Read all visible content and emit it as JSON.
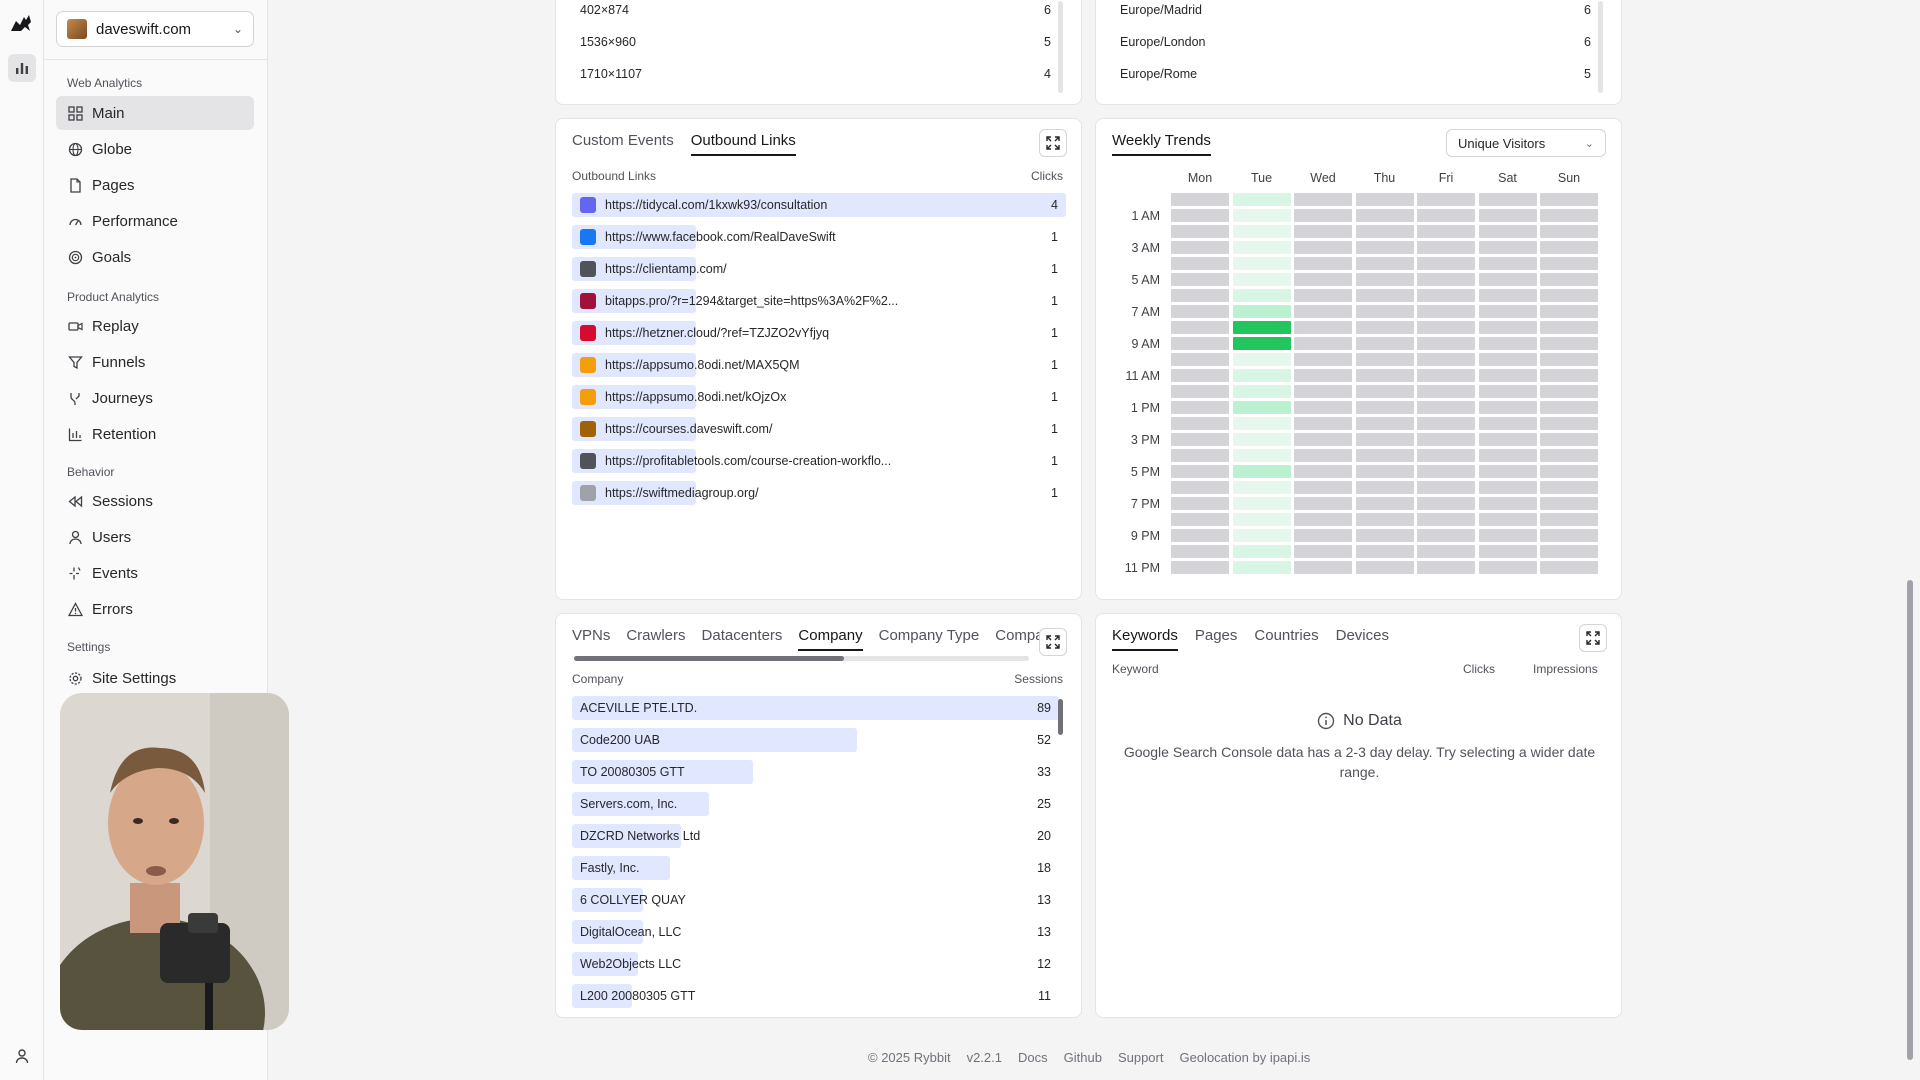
{
  "site_selector": {
    "name": "daveswift.com"
  },
  "sidebar": {
    "groups": [
      {
        "label": "Web Analytics",
        "items": [
          {
            "label": "Main",
            "icon": "grid-icon",
            "active": true
          },
          {
            "label": "Globe",
            "icon": "globe-icon"
          },
          {
            "label": "Pages",
            "icon": "file-icon"
          },
          {
            "label": "Performance",
            "icon": "gauge-icon"
          },
          {
            "label": "Goals",
            "icon": "target-icon"
          }
        ]
      },
      {
        "label": "Product Analytics",
        "items": [
          {
            "label": "Replay",
            "icon": "video-icon"
          },
          {
            "label": "Funnels",
            "icon": "funnel-icon"
          },
          {
            "label": "Journeys",
            "icon": "split-icon"
          },
          {
            "label": "Retention",
            "icon": "chart-icon"
          }
        ]
      },
      {
        "label": "Behavior",
        "items": [
          {
            "label": "Sessions",
            "icon": "rewind-icon"
          },
          {
            "label": "Users",
            "icon": "user-icon"
          },
          {
            "label": "Events",
            "icon": "sparkle-icon"
          },
          {
            "label": "Errors",
            "icon": "warning-icon"
          }
        ]
      },
      {
        "label": "Settings",
        "items": [
          {
            "label": "Site Settings",
            "icon": "gear-icon"
          }
        ]
      }
    ]
  },
  "screen_resolutions": {
    "rows": [
      {
        "label": "402×874",
        "value": "6"
      },
      {
        "label": "1536×960",
        "value": "5"
      },
      {
        "label": "1710×1107",
        "value": "4"
      }
    ]
  },
  "timezones": {
    "rows": [
      {
        "label": "Europe/Madrid",
        "value": "6"
      },
      {
        "label": "Europe/London",
        "value": "6"
      },
      {
        "label": "Europe/Rome",
        "value": "5"
      }
    ]
  },
  "events_card": {
    "tabs": [
      "Custom Events",
      "Outbound Links"
    ],
    "active_tab": 1,
    "col_label": "Outbound Links",
    "col_value": "Clicks",
    "rows": [
      {
        "url": "https://tidycal.com/1kxwk93/consultation",
        "clicks": "4",
        "share": 1.0,
        "icon": "calendar-icon",
        "color": "#6366f1"
      },
      {
        "url": "https://www.facebook.com/RealDaveSwift",
        "clicks": "1",
        "share": 0.25,
        "icon": "facebook-icon",
        "color": "#1877f2"
      },
      {
        "url": "https://clientamp.com/",
        "clicks": "1",
        "share": 0.25,
        "icon": "bars-icon",
        "color": "#52525b"
      },
      {
        "url": "bitapps.pro/?r=1294&target_site=https%3A%2F%2...",
        "clicks": "1",
        "share": 0.25,
        "icon": "bitapps-icon",
        "color": "#9f1239"
      },
      {
        "url": "https://hetzner.cloud/?ref=TZJZO2vYfjyq",
        "clicks": "1",
        "share": 0.25,
        "icon": "hetzner-icon",
        "color": "#d50c2d"
      },
      {
        "url": "https://appsumo.8odi.net/MAX5QM",
        "clicks": "1",
        "share": 0.25,
        "icon": "taco-icon",
        "color": "#f59e0b"
      },
      {
        "url": "https://appsumo.8odi.net/kOjzOx",
        "clicks": "1",
        "share": 0.25,
        "icon": "taco-icon",
        "color": "#f59e0b"
      },
      {
        "url": "https://courses.daveswift.com/",
        "clicks": "1",
        "share": 0.25,
        "icon": "avatar-icon",
        "color": "#a16207"
      },
      {
        "url": "https://profitabletools.com/course-creation-workflo...",
        "clicks": "1",
        "share": 0.25,
        "icon": "bars-icon",
        "color": "#52525b"
      },
      {
        "url": "https://swiftmediagroup.org/",
        "clicks": "1",
        "share": 0.25,
        "icon": "chevron-icon",
        "color": "#a1a1aa"
      }
    ]
  },
  "weekly_trends": {
    "title": "Weekly Trends",
    "metric": "Unique Visitors",
    "days": [
      "Mon",
      "Tue",
      "Wed",
      "Thu",
      "Fri",
      "Sat",
      "Sun"
    ],
    "hour_labels": [
      "1 AM",
      "3 AM",
      "5 AM",
      "7 AM",
      "9 AM",
      "11 AM",
      "1 PM",
      "3 PM",
      "5 PM",
      "7 PM",
      "9 PM",
      "11 PM"
    ],
    "tuesday_intensity": [
      0.1,
      0.05,
      0.05,
      0.05,
      0.05,
      0.05,
      0.1,
      0.35,
      0.9,
      1.0,
      0.05,
      0.1,
      0.1,
      0.3,
      0.05,
      0.05,
      0.05,
      0.35,
      0.05,
      0.05,
      0.05,
      0.05,
      0.1,
      0.1
    ]
  },
  "company_card": {
    "tabs": [
      "VPNs",
      "Crawlers",
      "Datacenters",
      "Company",
      "Company Type",
      "Compan"
    ],
    "active_tab": 3,
    "col_label": "Company",
    "col_value": "Sessions",
    "rows": [
      {
        "name": "ACEVILLE PTE.LTD.",
        "sessions": 89
      },
      {
        "name": "Code200 UAB",
        "sessions": 52
      },
      {
        "name": "TO 20080305 GTT",
        "sessions": 33
      },
      {
        "name": "Servers.com, Inc.",
        "sessions": 25
      },
      {
        "name": "DZCRD Networks Ltd",
        "sessions": 20
      },
      {
        "name": "Fastly, Inc.",
        "sessions": 18
      },
      {
        "name": "6 COLLYER QUAY",
        "sessions": 13
      },
      {
        "name": "DigitalOcean, LLC",
        "sessions": 13
      },
      {
        "name": "Web2Objects LLC",
        "sessions": 12
      },
      {
        "name": "L200 20080305 GTT",
        "sessions": 11
      }
    ]
  },
  "search_card": {
    "tabs": [
      "Keywords",
      "Pages",
      "Countries",
      "Devices"
    ],
    "active_tab": 0,
    "col_label": "Keyword",
    "col_clicks": "Clicks",
    "col_impressions": "Impressions",
    "empty_title": "No Data",
    "empty_message": "Google Search Console data has a 2-3 day delay. Try selecting a wider date range."
  },
  "footer": {
    "links": [
      "© 2025 Rybbit",
      "v2.2.1",
      "Docs",
      "Github",
      "Support",
      "Geolocation by ipapi.is"
    ]
  },
  "colors": {
    "accent_bar": "#e0e7ff",
    "heat_low": "#e6f7ee",
    "heat_high": "#22c55e",
    "heat_empty": "#d4d4d8"
  }
}
